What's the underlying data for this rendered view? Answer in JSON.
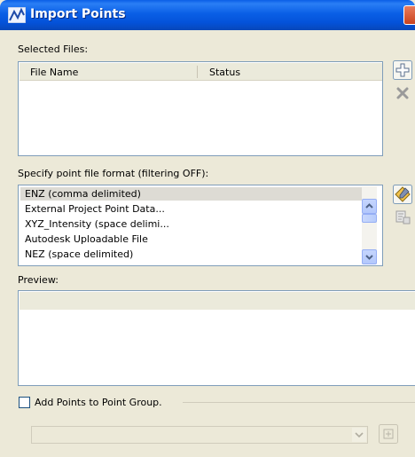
{
  "window": {
    "title": "Import Points",
    "app_icon": "autodesk-civil-icon",
    "close_icon": "close-icon"
  },
  "selected_files": {
    "label": "Selected Files:",
    "columns": [
      "File Name",
      "Status"
    ],
    "rows": [],
    "add_icon": "add-file-icon",
    "remove_icon": "remove-file-icon"
  },
  "point_format": {
    "label": "Specify point file format (filtering OFF):",
    "items": [
      "ENZ (comma delimited)",
      "External Project Point Data...",
      "XYZ_Intensity (space delimi...",
      "Autodesk Uploadable File",
      "NEZ (space delimited)"
    ],
    "selected_index": 0,
    "manage_icon": "point-file-formats-icon",
    "copy_icon": "copy-format-icon"
  },
  "preview": {
    "label": "Preview:"
  },
  "point_group": {
    "checkbox_label": "Add Points to Point Group.",
    "checked": false,
    "selected_value": "",
    "pick_icon": "create-point-group-icon"
  },
  "colors": {
    "titlebar": "#0a5fe6",
    "dialog_bg": "#ece9d8",
    "list_border": "#7f9db9",
    "selection": "#dddbd4"
  }
}
